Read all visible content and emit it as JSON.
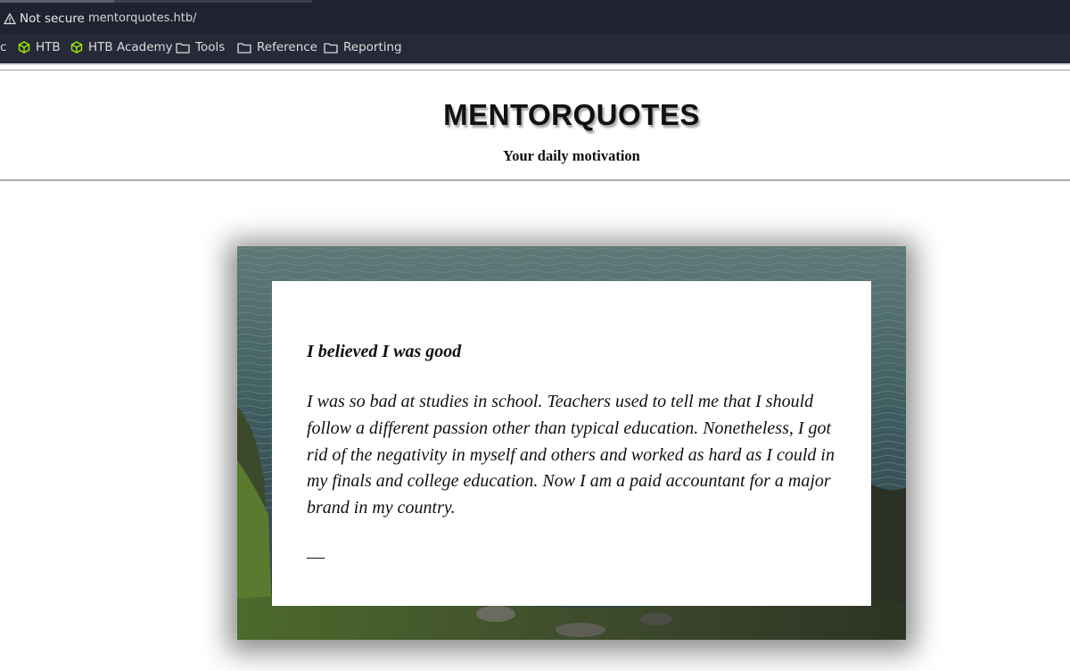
{
  "browser": {
    "security_label": "Not secure",
    "url": "mentorquotes.htb/",
    "bookmarks": [
      {
        "label": "HTB",
        "icon": "cube-icon"
      },
      {
        "label": "HTB Academy",
        "icon": "cube-icon"
      },
      {
        "label": "Tools",
        "icon": "folder-icon"
      },
      {
        "label": "Reference",
        "icon": "folder-icon"
      },
      {
        "label": "Reporting",
        "icon": "folder-icon"
      }
    ],
    "truncated_left_label": "c",
    "colors": {
      "chrome": "#1f2230",
      "bookmarks_bar": "#262a38",
      "htb_green": "#9fef00"
    }
  },
  "site": {
    "title": "MENTORQUOTES",
    "tagline": "Your daily motivation"
  },
  "quote": {
    "title": "I believed I was good",
    "body": "I was so bad at studies in school. Teachers used to tell me that I should follow a different passion other than typical education. Nonetheless, I got rid of the negativity in myself and others and worked as hard as I could in my finals and college education. Now I am a paid accountant for a major brand in my country.",
    "attribution": "—"
  }
}
